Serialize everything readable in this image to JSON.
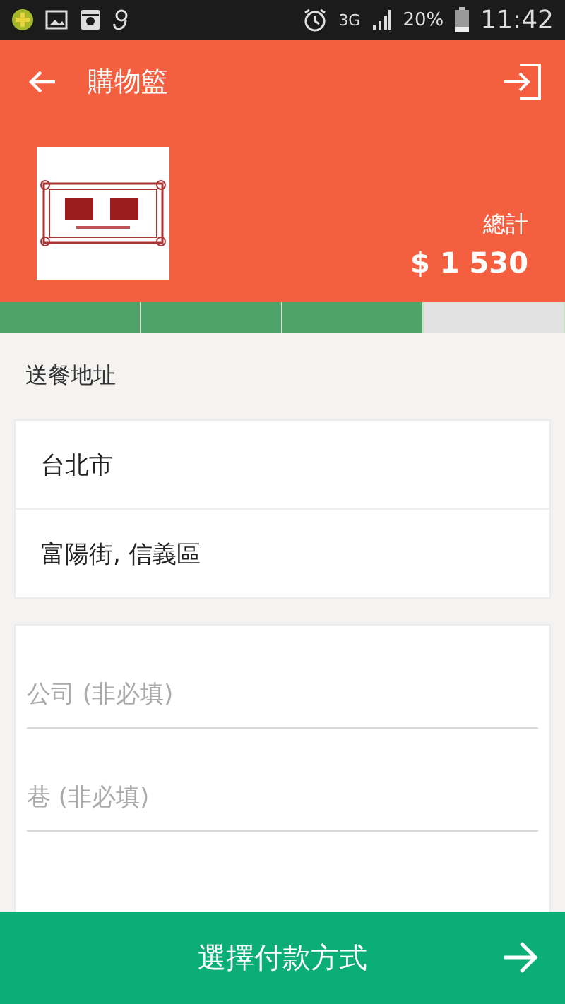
{
  "status_bar": {
    "network": "3G",
    "battery": "20%",
    "time": "11:42"
  },
  "app_bar": {
    "title": "購物籃"
  },
  "restaurant": {
    "total_label": "總計",
    "total": "$ 1 530"
  },
  "progress": [
    {
      "done": true
    },
    {
      "done": true
    },
    {
      "done": true
    },
    {
      "done": false
    }
  ],
  "section_title": "送餐地址",
  "address": [
    "台北市",
    "富陽街, 信義區"
  ],
  "fields": [
    {
      "placeholder": "公司 (非必填)"
    },
    {
      "placeholder": "巷 (非必填)"
    }
  ],
  "footer_button": {
    "label": "選擇付款方式"
  }
}
